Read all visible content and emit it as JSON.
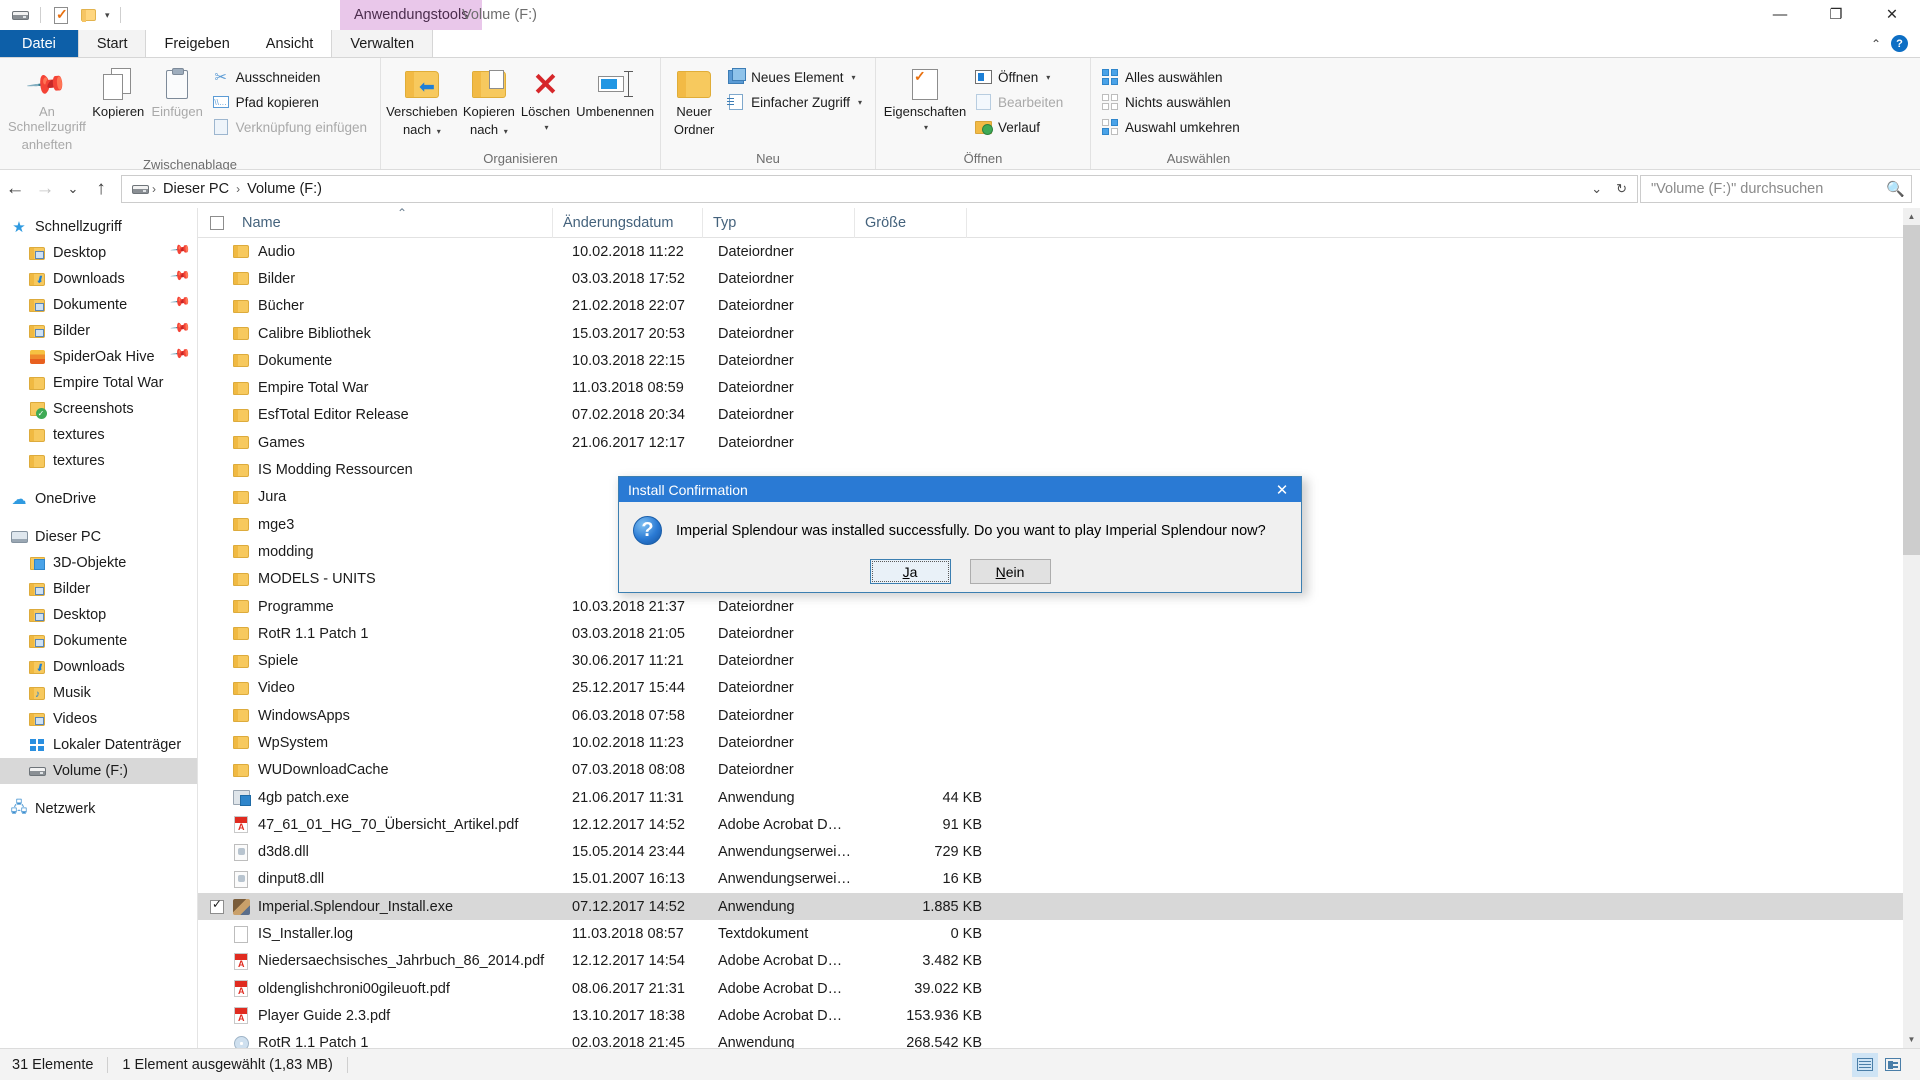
{
  "window": {
    "context_tab_label": "Anwendungstools",
    "title": "Volume (F:)",
    "minimize": "—",
    "maximize": "❐",
    "close": "✕",
    "collapse_ribbon": "⌃",
    "help": "?"
  },
  "quick_access": {
    "drive_icon": "drive-icon",
    "properties_icon": "properties-icon",
    "new_folder_icon": "new-folder-icon",
    "customize_caret": "▾"
  },
  "tabs": [
    {
      "label": "Datei",
      "name": "tab-datei"
    },
    {
      "label": "Start",
      "name": "tab-start"
    },
    {
      "label": "Freigeben",
      "name": "tab-freigeben"
    },
    {
      "label": "Ansicht",
      "name": "tab-ansicht"
    },
    {
      "label": "Verwalten",
      "name": "tab-verwalten"
    }
  ],
  "ribbon": {
    "groups": [
      {
        "title": "Zwischenablage"
      },
      {
        "title": "Organisieren"
      },
      {
        "title": "Neu"
      },
      {
        "title": "Öffnen"
      },
      {
        "title": "Auswählen"
      }
    ],
    "pin_quick_access": "An Schnellzugriff\nanheften",
    "pin_quick_access_l1": "An Schnellzugriff",
    "pin_quick_access_l2": "anheften",
    "copy": "Kopieren",
    "paste": "Einfügen",
    "cut": "Ausschneiden",
    "copy_path": "Pfad kopieren",
    "paste_shortcut": "Verknüpfung einfügen",
    "move_to_l1": "Verschieben",
    "move_to_l2": "nach",
    "copy_to_l1": "Kopieren",
    "copy_to_l2": "nach",
    "delete": "Löschen",
    "rename": "Umbenennen",
    "new_folder_l1": "Neuer",
    "new_folder_l2": "Ordner",
    "new_item": "Neues Element",
    "easy_access": "Einfacher Zugriff",
    "properties": "Eigenschaften",
    "open": "Öffnen",
    "edit": "Bearbeiten",
    "history": "Verlauf",
    "select_all": "Alles auswählen",
    "select_none": "Nichts auswählen",
    "invert_selection": "Auswahl umkehren",
    "caret": "▾"
  },
  "address": {
    "back": "←",
    "forward": "→",
    "recent": "⌄",
    "up": "↑",
    "drive_icon": "drive-icon",
    "crumbs": [
      "Dieser PC",
      "Volume (F:)"
    ],
    "crumb_sep": "›",
    "dropdown": "⌄",
    "refresh": "↻"
  },
  "search": {
    "value": "",
    "placeholder": "\"Volume (F:)\" durchsuchen",
    "icon": "search-icon"
  },
  "navpane": {
    "sections": [
      {
        "label": "Schnellzugriff",
        "icon": "quick-access-star-icon",
        "items": [
          {
            "label": "Desktop",
            "icon": "folder-desktop-icon",
            "pinned": true
          },
          {
            "label": "Downloads",
            "icon": "folder-downloads-icon",
            "pinned": true
          },
          {
            "label": "Dokumente",
            "icon": "folder-documents-icon",
            "pinned": true
          },
          {
            "label": "Bilder",
            "icon": "folder-pictures-icon",
            "pinned": true
          },
          {
            "label": "SpiderOak Hive",
            "icon": "spideroak-hive-icon",
            "pinned": true
          },
          {
            "label": "Empire Total War",
            "icon": "folder-icon",
            "pinned": false
          },
          {
            "label": "Screenshots",
            "icon": "folder-synced-icon",
            "pinned": false
          },
          {
            "label": "textures",
            "icon": "folder-icon",
            "pinned": false
          },
          {
            "label": "textures",
            "icon": "folder-icon",
            "pinned": false
          }
        ]
      },
      {
        "label": "OneDrive",
        "icon": "onedrive-cloud-icon",
        "items": []
      },
      {
        "label": "Dieser PC",
        "icon": "this-pc-icon",
        "items": [
          {
            "label": "3D-Objekte",
            "icon": "folder-3d-objects-icon",
            "pinned": false
          },
          {
            "label": "Bilder",
            "icon": "folder-pictures-icon",
            "pinned": false
          },
          {
            "label": "Desktop",
            "icon": "folder-desktop-icon",
            "pinned": false
          },
          {
            "label": "Dokumente",
            "icon": "folder-documents-icon",
            "pinned": false
          },
          {
            "label": "Downloads",
            "icon": "folder-downloads-icon",
            "pinned": false
          },
          {
            "label": "Musik",
            "icon": "folder-music-icon",
            "pinned": false
          },
          {
            "label": "Videos",
            "icon": "folder-videos-icon",
            "pinned": false
          },
          {
            "label": "Lokaler Datenträger",
            "icon": "local-disk-icon",
            "pinned": false
          },
          {
            "label": "Volume (F:)",
            "icon": "drive-icon",
            "pinned": false,
            "selected": true
          }
        ]
      },
      {
        "label": "Netzwerk",
        "icon": "network-icon",
        "items": []
      }
    ]
  },
  "filelist": {
    "columns": [
      {
        "label": "Name",
        "name": "column-name",
        "sorted": true,
        "sort_glyph": "⌃"
      },
      {
        "label": "Änderungsdatum",
        "name": "column-date-modified"
      },
      {
        "label": "Typ",
        "name": "column-type"
      },
      {
        "label": "Größe",
        "name": "column-size"
      }
    ],
    "rows": [
      {
        "name": "Audio",
        "date": "10.02.2018 11:22",
        "type": "Dateiordner",
        "size": "",
        "icon": "folder-icon"
      },
      {
        "name": "Bilder",
        "date": "03.03.2018 17:52",
        "type": "Dateiordner",
        "size": "",
        "icon": "folder-icon"
      },
      {
        "name": "Bücher",
        "date": "21.02.2018 22:07",
        "type": "Dateiordner",
        "size": "",
        "icon": "folder-icon"
      },
      {
        "name": "Calibre Bibliothek",
        "date": "15.03.2017 20:53",
        "type": "Dateiordner",
        "size": "",
        "icon": "folder-icon"
      },
      {
        "name": "Dokumente",
        "date": "10.03.2018 22:15",
        "type": "Dateiordner",
        "size": "",
        "icon": "folder-icon"
      },
      {
        "name": "Empire Total War",
        "date": "11.03.2018 08:59",
        "type": "Dateiordner",
        "size": "",
        "icon": "folder-icon"
      },
      {
        "name": "EsfTotal Editor Release",
        "date": "07.02.2018 20:34",
        "type": "Dateiordner",
        "size": "",
        "icon": "folder-icon"
      },
      {
        "name": "Games",
        "date": "21.06.2017 12:17",
        "type": "Dateiordner",
        "size": "",
        "icon": "folder-icon"
      },
      {
        "name": "IS Modding Ressourcen",
        "date": "",
        "type": "",
        "size": "",
        "icon": "folder-icon"
      },
      {
        "name": "Jura",
        "date": "",
        "type": "",
        "size": "",
        "icon": "folder-icon"
      },
      {
        "name": "mge3",
        "date": "",
        "type": "",
        "size": "",
        "icon": "folder-icon"
      },
      {
        "name": "modding",
        "date": "",
        "type": "",
        "size": "",
        "icon": "folder-icon"
      },
      {
        "name": "MODELS - UNITS",
        "date": "",
        "type": "",
        "size": "",
        "icon": "folder-icon"
      },
      {
        "name": "Programme",
        "date": "10.03.2018 21:37",
        "type": "Dateiordner",
        "size": "",
        "icon": "folder-icon"
      },
      {
        "name": "RotR 1.1 Patch 1",
        "date": "03.03.2018 21:05",
        "type": "Dateiordner",
        "size": "",
        "icon": "folder-icon"
      },
      {
        "name": "Spiele",
        "date": "30.06.2017 11:21",
        "type": "Dateiordner",
        "size": "",
        "icon": "folder-icon"
      },
      {
        "name": "Video",
        "date": "25.12.2017 15:44",
        "type": "Dateiordner",
        "size": "",
        "icon": "folder-icon"
      },
      {
        "name": "WindowsApps",
        "date": "06.03.2018 07:58",
        "type": "Dateiordner",
        "size": "",
        "icon": "folder-icon"
      },
      {
        "name": "WpSystem",
        "date": "10.02.2018 11:23",
        "type": "Dateiordner",
        "size": "",
        "icon": "folder-icon"
      },
      {
        "name": "WUDownloadCache",
        "date": "07.03.2018 08:08",
        "type": "Dateiordner",
        "size": "",
        "icon": "folder-icon"
      },
      {
        "name": "4gb patch.exe",
        "date": "21.06.2017 11:31",
        "type": "Anwendung",
        "size": "44 KB",
        "icon": "exe-icon"
      },
      {
        "name": "47_61_01_HG_70_Übersicht_Artikel.pdf",
        "date": "12.12.2017 14:52",
        "type": "Adobe Acrobat D…",
        "size": "91 KB",
        "icon": "pdf-icon"
      },
      {
        "name": "d3d8.dll",
        "date": "15.05.2014 23:44",
        "type": "Anwendungserwei…",
        "size": "729 KB",
        "icon": "dll-icon"
      },
      {
        "name": "dinput8.dll",
        "date": "15.01.2007 16:13",
        "type": "Anwendungserwei…",
        "size": "16 KB",
        "icon": "dll-icon"
      },
      {
        "name": "Imperial.Splendour_Install.exe",
        "date": "07.12.2017 14:52",
        "type": "Anwendung",
        "size": "1.885 KB",
        "icon": "game-exe-icon",
        "selected": true
      },
      {
        "name": "IS_Installer.log",
        "date": "11.03.2018 08:57",
        "type": "Textdokument",
        "size": "0 KB",
        "icon": "text-icon"
      },
      {
        "name": "Niedersaechsisches_Jahrbuch_86_2014.pdf",
        "date": "12.12.2017 14:54",
        "type": "Adobe Acrobat D…",
        "size": "3.482 KB",
        "icon": "pdf-icon"
      },
      {
        "name": "oldenglishchroni00gileuoft.pdf",
        "date": "08.06.2017 21:31",
        "type": "Adobe Acrobat D…",
        "size": "39.022 KB",
        "icon": "pdf-icon"
      },
      {
        "name": "Player Guide 2.3.pdf",
        "date": "13.10.2017 18:38",
        "type": "Adobe Acrobat D…",
        "size": "153.936 KB",
        "icon": "pdf-icon"
      },
      {
        "name": "RotR 1.1 Patch 1",
        "date": "02.03.2018 21:45",
        "type": "Anwendung",
        "size": "268.542 KB",
        "icon": "disc-icon"
      }
    ]
  },
  "dialog": {
    "title": "Install Confirmation",
    "close": "✕",
    "icon": "question-icon",
    "message": "Imperial Splendour was installed successfully. Do you want to play Imperial Splendour now?",
    "yes_prefix": "",
    "yes_accel": "J",
    "yes_rest": "a",
    "no_accel": "N",
    "no_rest": "ein"
  },
  "statusbar": {
    "item_count": "31 Elemente",
    "selection": "1 Element ausgewählt (1,83 MB)",
    "details_view_icon": "details-view-icon",
    "tile_view_icon": "tile-view-icon"
  },
  "colors": {
    "accent": "#0d5fa8",
    "dialog_title": "#2a7ad4",
    "context_tab": "#e9c7ea",
    "selection": "#d8d8d8"
  }
}
